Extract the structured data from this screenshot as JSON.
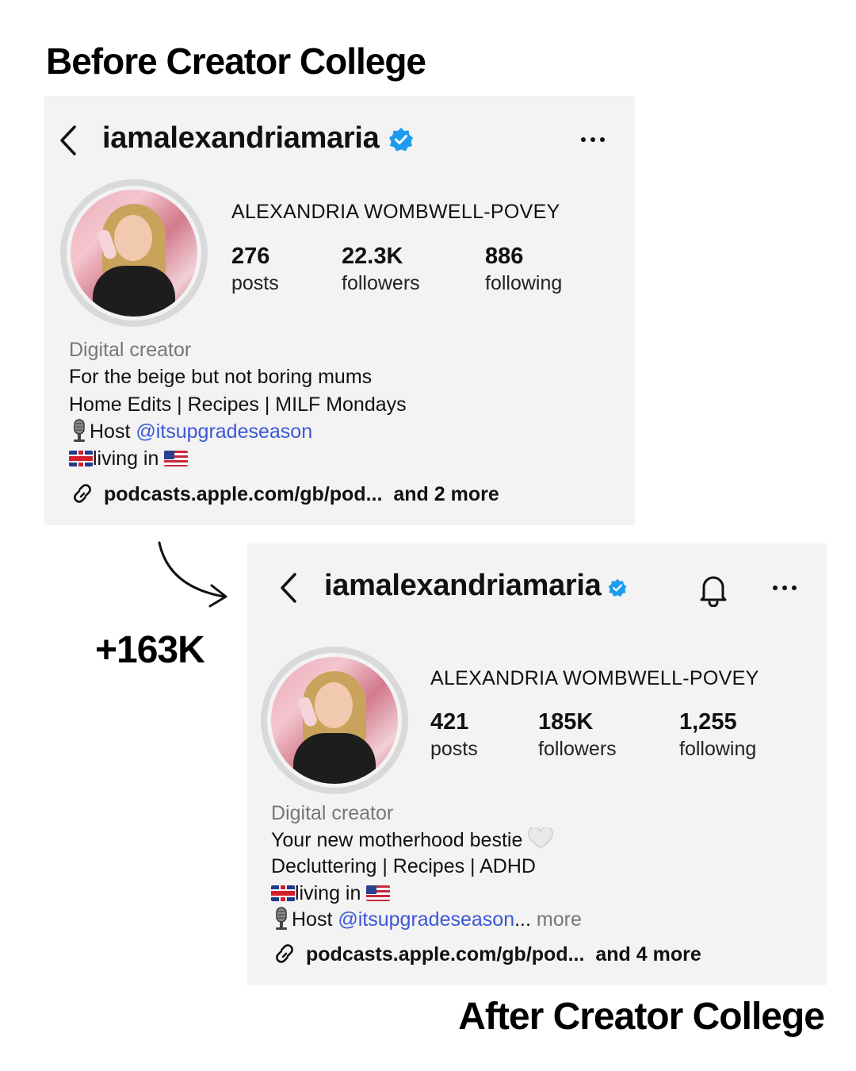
{
  "headings": {
    "before": "Before Creator College",
    "after": "After Creator College",
    "delta": "+163K"
  },
  "before": {
    "username": "iamalexandriamaria",
    "full_name": "ALEXANDRIA WOMBWELL-POVEY",
    "stats": [
      {
        "value": "276",
        "label": "posts"
      },
      {
        "value": "22.3K",
        "label": "followers"
      },
      {
        "value": "886",
        "label": "following"
      }
    ],
    "bio": {
      "category": "Digital creator",
      "line1": "For the beige but not boring mums",
      "line2": "Home Edits | Recipes | MILF Mondays",
      "host_prefix": "Host ",
      "host_mention": "@itsupgradeseason",
      "living": "living in "
    },
    "link": {
      "url": "podcasts.apple.com/gb/pod...",
      "extra": "and 2 more"
    }
  },
  "after": {
    "username": "iamalexandriamaria",
    "full_name": "ALEXANDRIA WOMBWELL-POVEY",
    "stats": [
      {
        "value": "421",
        "label": "posts"
      },
      {
        "value": "185K",
        "label": "followers"
      },
      {
        "value": "1,255",
        "label": "following"
      }
    ],
    "bio": {
      "category": "Digital creator",
      "line1": "Your new motherhood bestie ",
      "line2": "Decluttering | Recipes | ADHD",
      "living": "living in ",
      "host_prefix": "Host ",
      "host_mention": "@itsupgradeseason",
      "ellipsis": "...",
      "more": " more"
    },
    "link": {
      "url": "podcasts.apple.com/gb/pod...",
      "extra": "and 4 more"
    }
  },
  "icons": [
    "back-icon",
    "verified-icon",
    "more-icon",
    "bell-icon",
    "link-icon",
    "microphone-icon",
    "uk-flag-icon",
    "us-flag-icon",
    "white-heart-icon",
    "curved-arrow-icon"
  ],
  "colors": {
    "card_bg": "#f3f3f3",
    "verified": "#1d9bf0",
    "mention": "#3b57d6",
    "muted": "#777777"
  }
}
